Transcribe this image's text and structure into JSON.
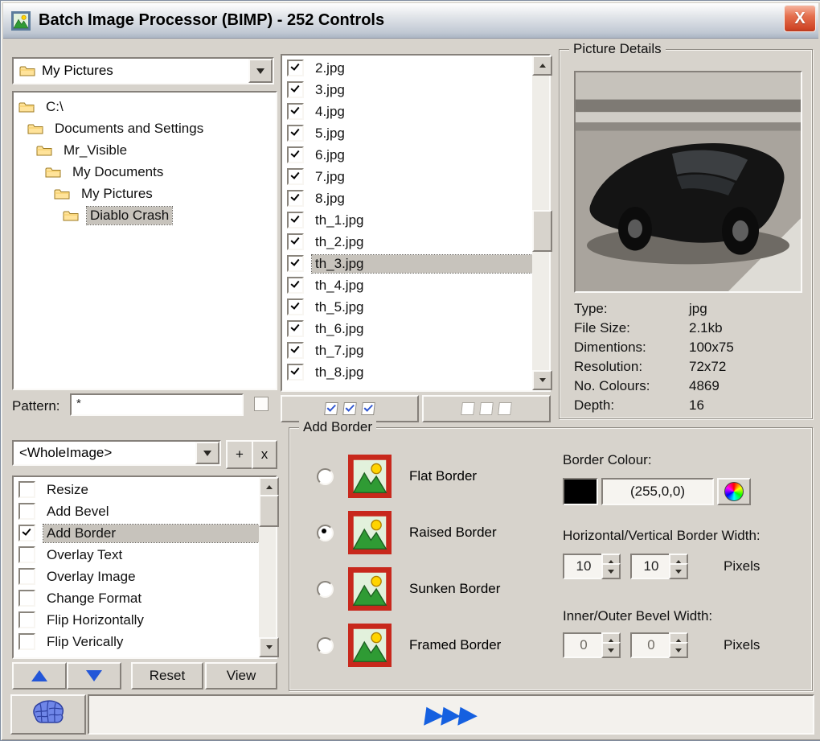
{
  "window": {
    "title": "Batch Image Processor (BIMP) - 252 Controls",
    "close_label": "X"
  },
  "folders": {
    "combo_value": "My Pictures",
    "tree": [
      {
        "label": "C:\\",
        "level": 0,
        "selected": false
      },
      {
        "label": "Documents and Settings",
        "level": 1,
        "selected": false
      },
      {
        "label": "Mr_Visible",
        "level": 2,
        "selected": false
      },
      {
        "label": "My Documents",
        "level": 3,
        "selected": false
      },
      {
        "label": "My Pictures",
        "level": 4,
        "selected": false
      },
      {
        "label": "Diablo Crash",
        "level": 5,
        "selected": true
      }
    ],
    "pattern_label": "Pattern:",
    "pattern_value": "*"
  },
  "files": {
    "items": [
      {
        "name": "2.jpg",
        "checked": true,
        "selected": false
      },
      {
        "name": "3.jpg",
        "checked": true,
        "selected": false
      },
      {
        "name": "4.jpg",
        "checked": true,
        "selected": false
      },
      {
        "name": "5.jpg",
        "checked": true,
        "selected": false
      },
      {
        "name": "6.jpg",
        "checked": true,
        "selected": false
      },
      {
        "name": "7.jpg",
        "checked": true,
        "selected": false
      },
      {
        "name": "8.jpg",
        "checked": true,
        "selected": false
      },
      {
        "name": "th_1.jpg",
        "checked": true,
        "selected": false
      },
      {
        "name": "th_2.jpg",
        "checked": true,
        "selected": false
      },
      {
        "name": "th_3.jpg",
        "checked": true,
        "selected": true
      },
      {
        "name": "th_4.jpg",
        "checked": true,
        "selected": false
      },
      {
        "name": "th_5.jpg",
        "checked": true,
        "selected": false
      },
      {
        "name": "th_6.jpg",
        "checked": true,
        "selected": false
      },
      {
        "name": "th_7.jpg",
        "checked": true,
        "selected": false
      },
      {
        "name": "th_8.jpg",
        "checked": true,
        "selected": false
      }
    ]
  },
  "picture_details": {
    "title": "Picture Details",
    "fields": [
      {
        "label": "Type:",
        "value": "jpg"
      },
      {
        "label": "File Size:",
        "value": "2.1kb"
      },
      {
        "label": "Dimentions:",
        "value": "100x75"
      },
      {
        "label": "Resolution:",
        "value": "72x72"
      },
      {
        "label": "No. Colours:",
        "value": "4869"
      },
      {
        "label": "Depth:",
        "value": "16"
      }
    ]
  },
  "effects": {
    "combo_value": "<WholeImage>",
    "add_label": "+",
    "remove_label": "x",
    "items": [
      {
        "label": "Resize",
        "checked": false,
        "selected": false
      },
      {
        "label": "Add Bevel",
        "checked": false,
        "selected": false
      },
      {
        "label": "Add Border",
        "checked": true,
        "selected": true
      },
      {
        "label": "Overlay Text",
        "checked": false,
        "selected": false
      },
      {
        "label": "Overlay Image",
        "checked": false,
        "selected": false
      },
      {
        "label": "Change Format",
        "checked": false,
        "selected": false
      },
      {
        "label": "Flip Horizontally",
        "checked": false,
        "selected": false
      },
      {
        "label": "Flip Verically",
        "checked": false,
        "selected": false
      }
    ],
    "reset_label": "Reset",
    "view_label": "View"
  },
  "add_border": {
    "title": "Add Border",
    "options": [
      {
        "label": "Flat Border",
        "selected": false
      },
      {
        "label": "Raised Border",
        "selected": true
      },
      {
        "label": "Sunken Border",
        "selected": false
      },
      {
        "label": "Framed Border",
        "selected": false
      }
    ],
    "border_colour_label": "Border Colour:",
    "border_colour_value": "(255,0,0)",
    "swatch_color": "#000000",
    "hv_label": "Horizontal/Vertical Border Width:",
    "h_value": "10",
    "v_value": "10",
    "pixels_label": "Pixels",
    "bevel_label": "Inner/Outer Bevel Width:",
    "inner_value": "0",
    "outer_value": "0",
    "pixels_label2": "Pixels"
  },
  "bottom": {
    "run_glyph": "▶▶▶"
  },
  "icons": {
    "app-icon": "mountain-sun-image",
    "close-icon": "X",
    "folder-icon": "yellow-folder",
    "chevron-down-icon": "▼",
    "check-icon": "✓",
    "move-up-icon": "blue-triangle-up",
    "move-down-icon": "blue-triangle-down",
    "brain-icon": "blue-brain",
    "run-icon": "▶▶▶",
    "color-wheel-icon": "rainbow-circle"
  },
  "colors": {
    "accent_blue": "#1560e0",
    "selection_gray": "#c7c3bc",
    "window_bg": "#d7d3cc"
  }
}
